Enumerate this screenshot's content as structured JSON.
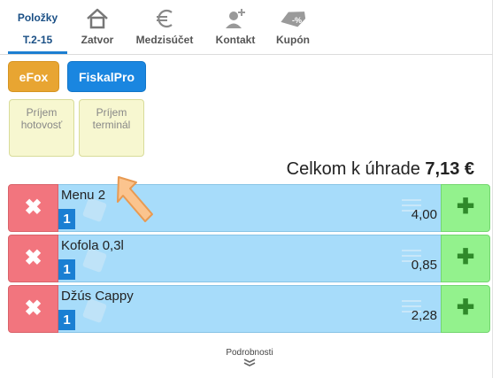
{
  "tabs": [
    {
      "top": "Položky",
      "label": "T.2-15",
      "icon": "list-tab",
      "active": true
    },
    {
      "label": "Zatvor",
      "icon": "home-icon"
    },
    {
      "label": "Medzisúčet",
      "icon": "euro-icon"
    },
    {
      "label": "Kontakt",
      "icon": "add-person-icon"
    },
    {
      "label": "Kupón",
      "icon": "coupon-tag-icon"
    }
  ],
  "payments": {
    "efox": "eFox",
    "fiskalpro": "FiskalPro",
    "cash_line1": "Príjem",
    "cash_line2": "hotovosť",
    "terminal_line1": "Príjem",
    "terminal_line2": "terminál"
  },
  "total": {
    "label": "Celkom k úhrade",
    "amount": "7,13 €"
  },
  "items": [
    {
      "name": "Menu 2",
      "qty": "1",
      "price": "4,00"
    },
    {
      "name": "Kofola 0,3l",
      "qty": "1",
      "price": "0,85"
    },
    {
      "name": "Džús Cappy",
      "qty": "1",
      "price": "2,28"
    }
  ],
  "footer": {
    "details": "Podrobnosti"
  },
  "colors": {
    "accent": "#1c7fd1",
    "efox": "#e8a532",
    "fiskalpro": "#1a86e0",
    "delete": "#f2757e",
    "add": "#93f28d",
    "item": "#a7dcfa",
    "tile": "#f7f7d0"
  }
}
